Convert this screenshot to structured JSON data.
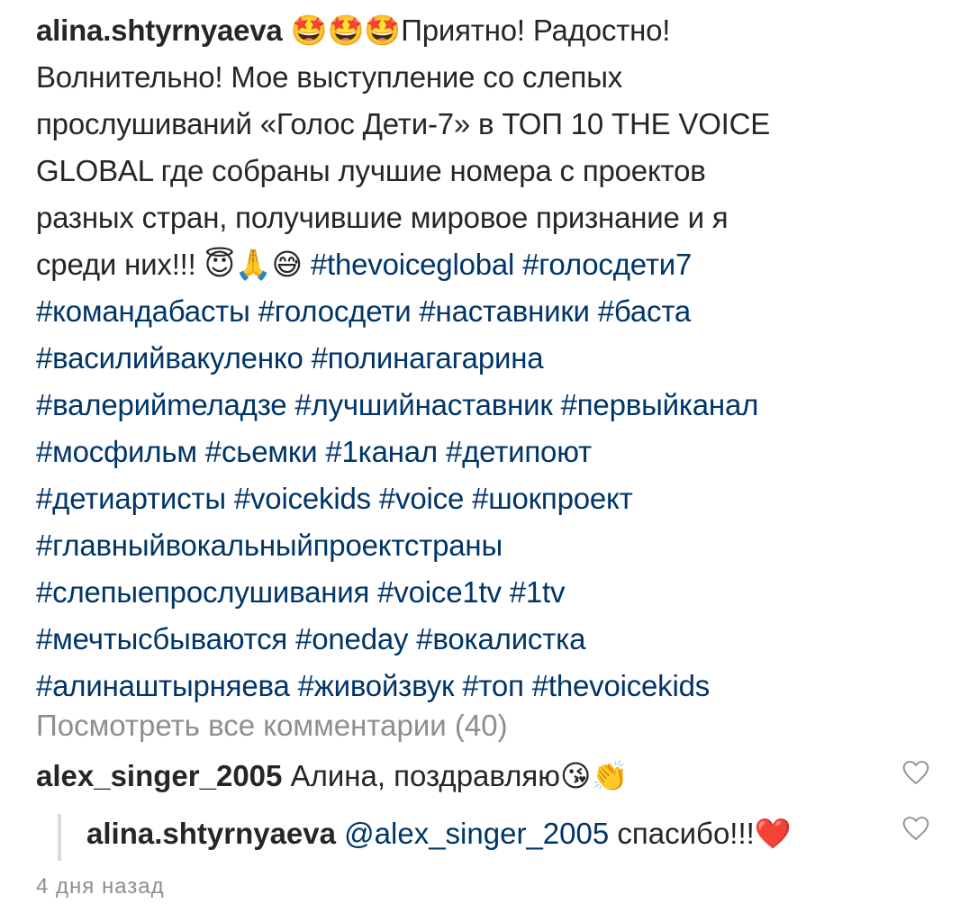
{
  "caption": {
    "username": "alina.shtyrnyaeva",
    "intro_emojis": "🤩🤩🤩",
    "line1_text": "Приятно! Радостно!",
    "line2": "Волнительно! Мое выступление со слепых",
    "line3": "прослушиваний «Голос Дети-7» в ТОП 10 THE VOICE",
    "line4": "GLOBAL где собраны лучшие номера с проектов",
    "line5": "разных стран, получившие мировое признание и я",
    "line6_text": "среди них!!!",
    "line6_emojis": "😇🙏😅",
    "hashtags": [
      "#thevoiceglobal",
      "#голосдети7",
      "#командабасты",
      "#голосдети",
      "#наставники",
      "#баста",
      "#василийвакуленко",
      "#полинагагарина",
      "#валерийmеладзе",
      "#лучшийнаставник",
      "#первыйканал",
      "#мосфильм",
      "#сьемки",
      "#1канал",
      "#детипоют",
      "#детиартисты",
      "#voicekids",
      "#voice",
      "#шокпроект",
      "#главныйвокальныйпроектстраны",
      "#слепыепрослушивания",
      "#voice1tv",
      "#1tv",
      "#мечтысбываются",
      "#oneday",
      "#вокалистка",
      "#алинаштырняева",
      "#живойзвук",
      "#топ",
      "#thevoicekids"
    ]
  },
  "view_all_comments": "Посмотреть все комментарии (40)",
  "comment": {
    "username": "alex_singer_2005",
    "text": "Алина, поздравляю",
    "emojis": "😘👏"
  },
  "reply": {
    "username": "alina.shtyrnyaeva",
    "mention": "@alex_singer_2005",
    "text": "спасибо!!!",
    "emoji": "❤️"
  },
  "timestamp": "4 дня назад",
  "colors": {
    "text": "#262626",
    "hashtag": "#003569",
    "muted": "#8e8e8e",
    "heart_outline": "#8e8e8e",
    "reply_bar": "#dbdbdb"
  },
  "icons": {
    "like_comment": "heart-outline-icon",
    "like_reply": "heart-outline-icon"
  }
}
